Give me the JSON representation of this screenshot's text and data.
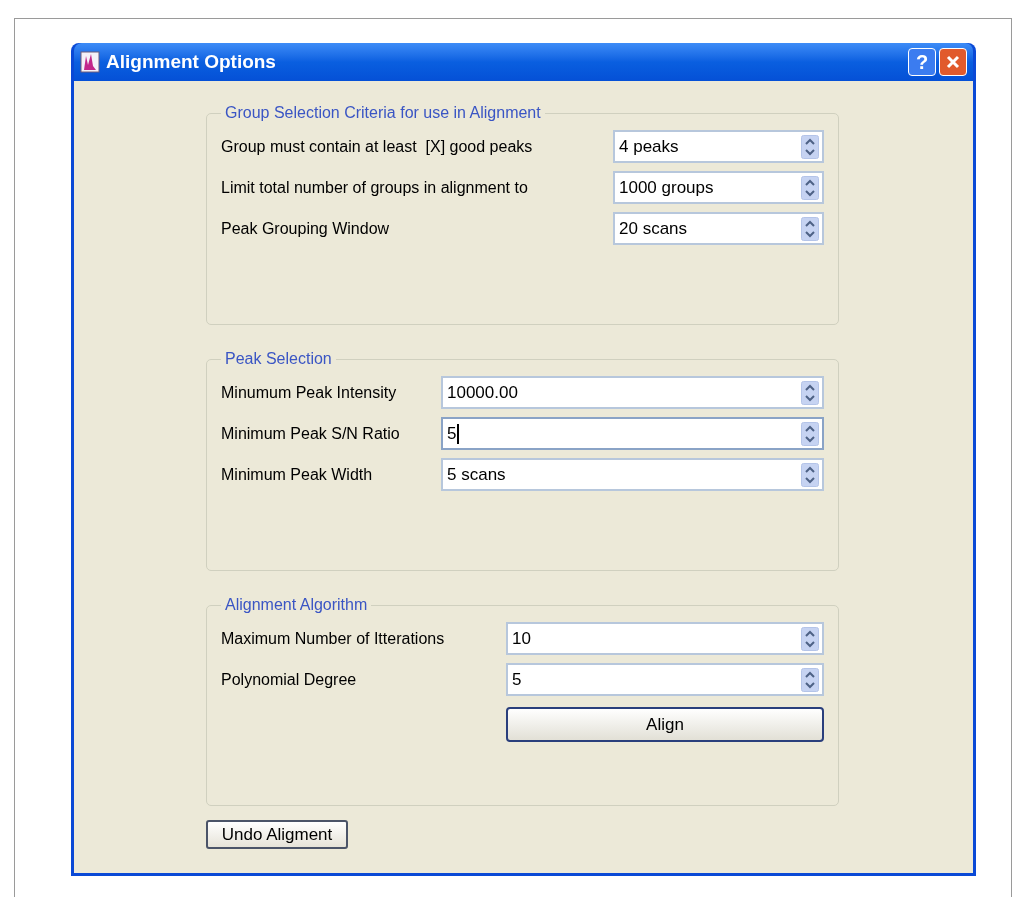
{
  "window": {
    "title": "Alignment Options",
    "buttons": [
      {
        "kind": "help",
        "label": "?"
      },
      {
        "kind": "close"
      }
    ]
  },
  "groups": [
    {
      "title": "Group Selection Criteria for use in Alignment",
      "fields": [
        {
          "label": "Group must contain at least  [X] good peaks",
          "value": "4 peaks",
          "focused": false
        },
        {
          "label": "Limit total number of groups in alignment to",
          "value": "1000 groups",
          "focused": false
        },
        {
          "label": "Peak Grouping Window",
          "value": "20 scans",
          "focused": false
        }
      ]
    },
    {
      "title": "Peak Selection",
      "fields": [
        {
          "label": "Minumum Peak Intensity",
          "value": "10000.00",
          "focused": false
        },
        {
          "label": "Minimum Peak S/N Ratio",
          "value": "5",
          "focused": true
        },
        {
          "label": "Minimum Peak Width",
          "value": "5 scans",
          "focused": false
        }
      ]
    },
    {
      "title": "Alignment Algorithm",
      "fields": [
        {
          "label": "Maximum Number of Itterations",
          "value": "10",
          "focused": false
        },
        {
          "label": "Polynomial Degree",
          "value": "5",
          "focused": false
        }
      ],
      "button": "Align"
    }
  ],
  "footer_button": "Undo Aligment"
}
